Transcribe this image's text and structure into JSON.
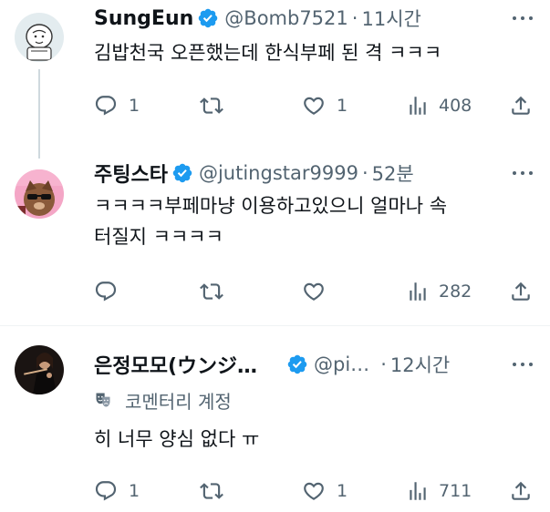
{
  "tweets": [
    {
      "name": "SungEun",
      "handle": "@Bomb7521",
      "separator": "·",
      "time": "11시간",
      "text_lines": [
        "김밥천국 오픈했는데 한식부페 된 격 ㅋㅋㅋ"
      ],
      "reply_count": "1",
      "retweet_count": "",
      "like_count": "1",
      "view_count": "408"
    },
    {
      "name": "주팅스타",
      "handle": "@jutingstar9999",
      "separator": "·",
      "time": "52분",
      "text_lines": [
        "ㅋㅋㅋㅋ부페마냥 이용하고있으니 얼마나 속",
        "터질지 ㅋㅋㅋㅋ"
      ],
      "reply_count": "",
      "retweet_count": "",
      "like_count": "",
      "view_count": "282"
    },
    {
      "name": "은정모모(ウンジ…",
      "handle": "@pi…",
      "separator": "·",
      "time": "12시간",
      "community_label": "코멘터리 계정",
      "text_lines": [
        "히 너무 양심 없다 ㅠ"
      ],
      "reply_count": "1",
      "retweet_count": "",
      "like_count": "1",
      "view_count": "711"
    }
  ],
  "icons": {
    "verified": "verified-badge-icon",
    "reply": "reply-icon",
    "retweet": "retweet-icon",
    "like": "heart-icon",
    "views": "views-chart-icon",
    "share": "share-icon",
    "more": "more-dots-icon",
    "community": "theater-masks-icon"
  },
  "colors": {
    "verified_blue": "#1d9bf0",
    "secondary_text": "#536471",
    "primary_text": "#0f1419"
  }
}
